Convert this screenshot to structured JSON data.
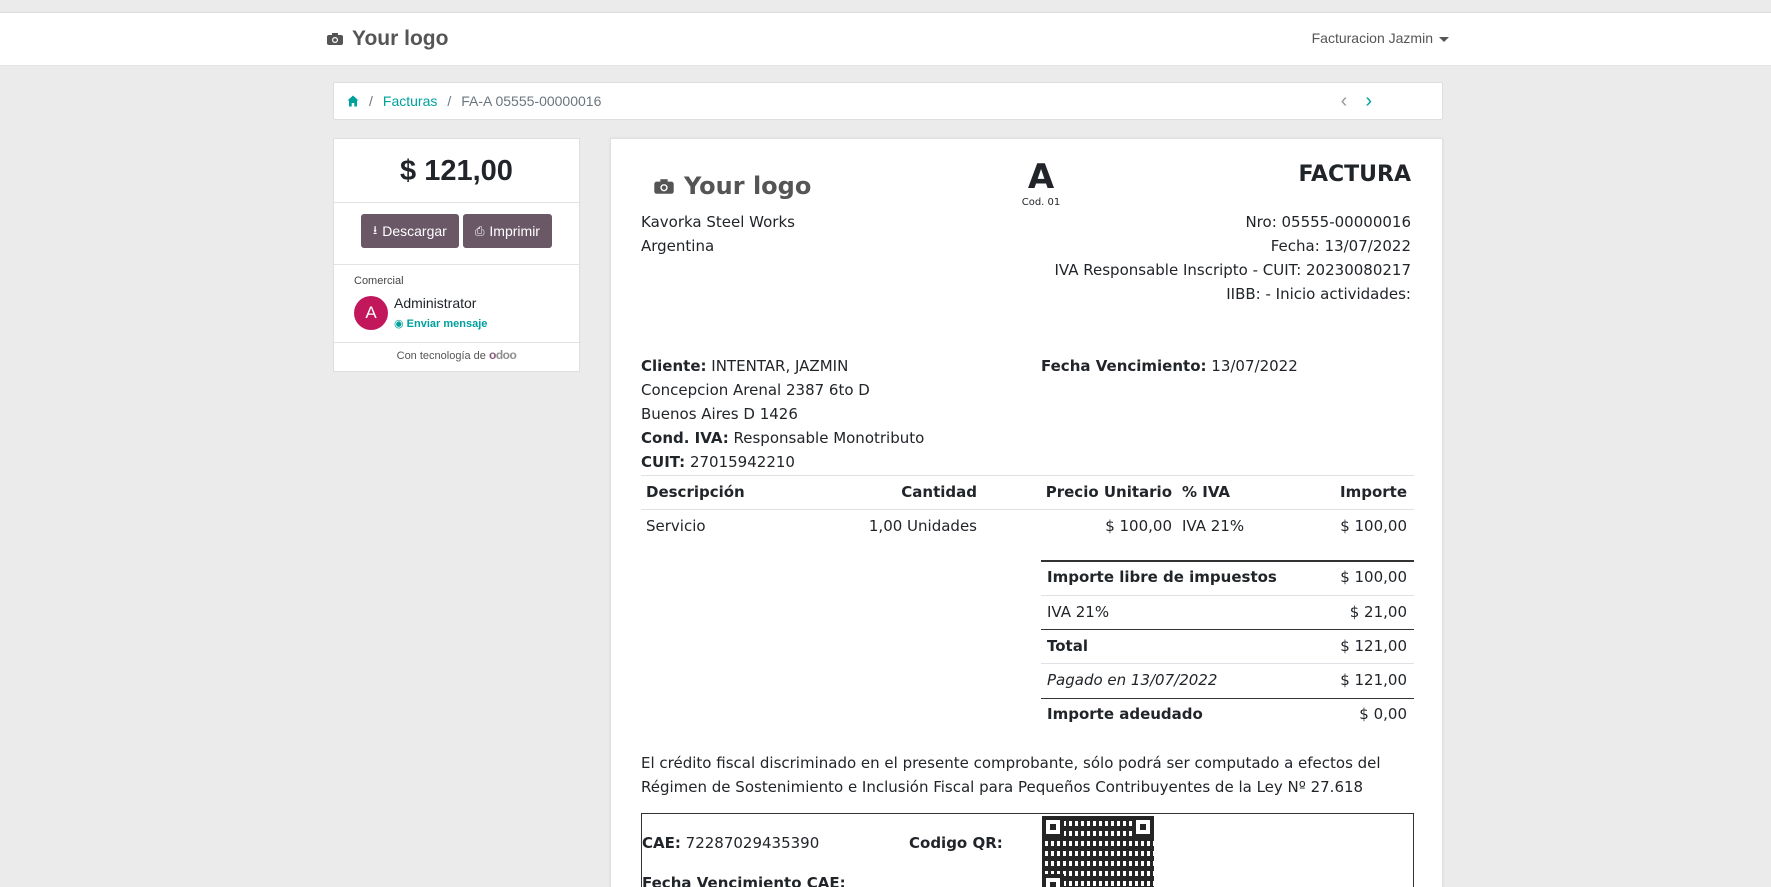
{
  "navbar": {
    "logo_text": "Your logo",
    "user_menu": "Facturacion Jazmin"
  },
  "breadcrumb": {
    "items": [
      "Facturas",
      "FA-A 05555-00000016"
    ]
  },
  "sidebar": {
    "amount": "$ 121,00",
    "download_label": "Descargar",
    "print_label": "Imprimir",
    "salesperson_label": "Comercial",
    "salesperson_name": "Administrator",
    "avatar_letter": "A",
    "send_message_label": "Enviar mensaje",
    "powered_by": "Con tecnología de",
    "odoo_text": "odoo"
  },
  "invoice": {
    "logo_text": "Your logo",
    "letter": "A",
    "letter_code": "Cod. 01",
    "title": "FACTURA",
    "company_name": "Kavorka Steel Works",
    "company_country": "Argentina",
    "number": "Nro: 05555-00000016",
    "date": "Fecha: 13/07/2022",
    "iva_cuit": "IVA Responsable Inscripto - CUIT: 20230080217",
    "iibb": "IIBB: - Inicio actividades:",
    "client_label": "Cliente:",
    "client_name": "INTENTAR, JAZMIN",
    "client_address1": "Concepcion Arenal 2387 6to D",
    "client_address2": "Buenos Aires D 1426",
    "cond_iva_label": "Cond. IVA:",
    "cond_iva_value": "Responsable Monotributo",
    "cuit_label": "CUIT:",
    "cuit_value": "27015942210",
    "due_label": "Fecha Vencimiento:",
    "due_value": "13/07/2022",
    "table": {
      "headers": [
        "Descripción",
        "Cantidad",
        "Precio Unitario",
        "% IVA",
        "Importe"
      ],
      "rows": [
        [
          "Servicio",
          "1,00 Unidades",
          "$ 100,00",
          "IVA 21%",
          "$ 100,00"
        ]
      ]
    },
    "totals": [
      {
        "label": "Importe libre de impuestos",
        "value": "$ 100,00"
      },
      {
        "label": "IVA 21%",
        "value": "$ 21,00"
      },
      {
        "label": "Total",
        "value": "$ 121,00"
      },
      {
        "label": "Pagado en 13/07/2022",
        "value": "$ 121,00"
      },
      {
        "label": "Importe adeudado",
        "value": "$ 0,00"
      }
    ],
    "legal_text": "El crédito fiscal discriminado en el presente comprobante, sólo podrá ser computado a efectos del Régimen de Sostenimiento e Inclusión Fiscal para Pequeños Contribuyentes de la Ley Nº 27.618",
    "cae_label": "CAE:",
    "cae_value": "72287029435390",
    "qr_label": "Codigo QR:",
    "cae_due_label": "Fecha Vencimiento CAE:"
  },
  "colors": {
    "accent": "#00a09d",
    "button": "#6a5867",
    "avatar": "#c2185b"
  }
}
